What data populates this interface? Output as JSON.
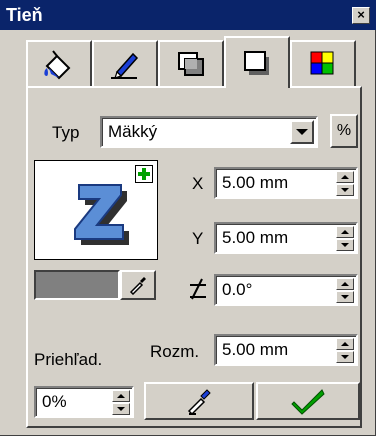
{
  "window": {
    "title": "Tieň",
    "close_label": "×"
  },
  "tabs": [
    {
      "name": "fill-tab",
      "icon": "paint-bucket-icon"
    },
    {
      "name": "outline-tab",
      "icon": "pen-icon"
    },
    {
      "name": "transparency-tab",
      "icon": "transparency-icon"
    },
    {
      "name": "shadow-tab",
      "icon": "shadow-icon",
      "active": true
    },
    {
      "name": "color-tab",
      "icon": "color-grid-icon"
    }
  ],
  "type_row": {
    "label": "Typ",
    "value": "Mäkký",
    "percent_label": "%"
  },
  "preview": {
    "glyph": "Z",
    "add_label": "+"
  },
  "fields": {
    "x": {
      "label": "X",
      "value": "5.00 mm"
    },
    "y": {
      "label": "Y",
      "value": "5.00 mm"
    },
    "angle": {
      "value": "0.0°"
    },
    "size": {
      "label": "Rozm.",
      "value": "5.00 mm"
    }
  },
  "opacity": {
    "label": "Priehľad.",
    "value": "0%"
  },
  "colors": {
    "title_bar": "#0a246a",
    "face": "#d4d0c8",
    "shadow_swatch": "#808080",
    "letter_fill": "#5b8ed6",
    "plus_green": "#00a000",
    "check_green": "#00a000"
  }
}
